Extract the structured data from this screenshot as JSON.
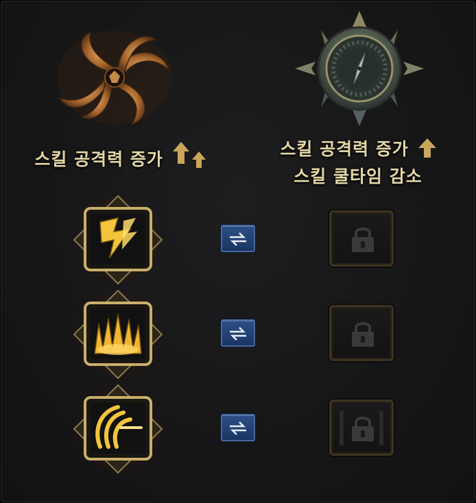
{
  "left_column": {
    "emblem": "swirl-emblem",
    "title": "스킬 공격력 증가",
    "arrow_icon": "double-up-arrow-icon",
    "accent_color": "#b8722e"
  },
  "right_column": {
    "emblem": "compass-emblem",
    "title_line1": "스킬 공격력 증가",
    "title_line2": "스킬 쿨타임 감소",
    "arrow_icon": "up-arrow-icon",
    "accent_color": "#4f5a4e"
  },
  "rows": [
    {
      "skill_icon": "lightning-claw-skill-icon",
      "swap_icon": "swap-arrows-icon",
      "slot_icon": "lock-icon",
      "locked": true
    },
    {
      "skill_icon": "flame-burst-skill-icon",
      "swap_icon": "swap-arrows-icon",
      "slot_icon": "lock-icon",
      "locked": true
    },
    {
      "skill_icon": "spiral-slash-skill-icon",
      "swap_icon": "swap-arrows-icon",
      "slot_icon": "lock-icon",
      "locked": true
    }
  ],
  "colors": {
    "title_text": "#e3d8a6",
    "gold_frame": "#bfa75c",
    "swap_button": "#2d4f86",
    "panel_bg": "#161617"
  }
}
